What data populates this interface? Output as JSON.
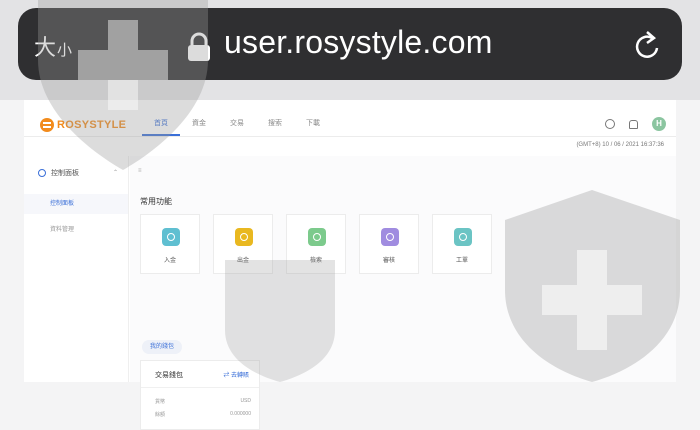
{
  "browser": {
    "text_size_large": "大",
    "text_size_small": "小",
    "url": "user.rosystyle.com"
  },
  "header": {
    "logo_text": "ROSYSTYLE",
    "nav": [
      "首頁",
      "資金",
      "交易",
      "搜索",
      "下載"
    ],
    "avatar_letter": "H",
    "datetime": "(GMT+8) 10 / 06 / 2021 16:37:36"
  },
  "sidebar": {
    "section_label": "控制面板",
    "items": [
      "控制面板",
      "資料管理"
    ]
  },
  "main": {
    "section_title": "常用功能",
    "functions": [
      {
        "label": "入金",
        "color": "#5fbfd1"
      },
      {
        "label": "出金",
        "color": "#e9b820"
      },
      {
        "label": "檢索",
        "color": "#7cca8c"
      },
      {
        "label": "審核",
        "color": "#a08ce0"
      },
      {
        "label": "工單",
        "color": "#6bc4c4"
      }
    ],
    "wallet_tab": "我的錢包",
    "wallet": {
      "title": "交易錢包",
      "link": "去轉賬",
      "rows": [
        {
          "label": "貨幣",
          "value": "USD"
        },
        {
          "label": "餘額",
          "value": "0.000000"
        }
      ]
    }
  }
}
